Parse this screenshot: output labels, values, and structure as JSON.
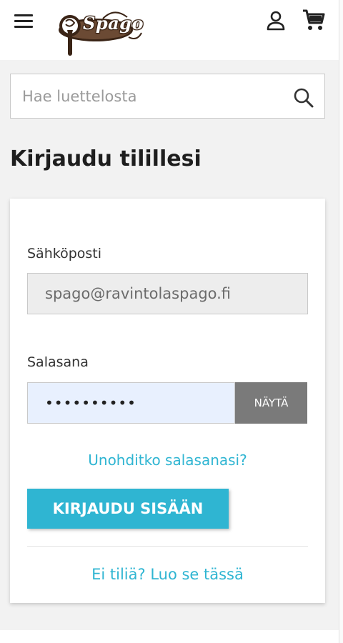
{
  "header": {
    "logo_text": "Spago",
    "menu_icon": "hamburger-menu-icon",
    "user_icon": "user-icon",
    "cart_icon": "shopping-cart-icon"
  },
  "search": {
    "placeholder": "Hae luettelosta",
    "value": "",
    "icon": "search-icon"
  },
  "page": {
    "title": "Kirjaudu tilillesi"
  },
  "login_form": {
    "email_label": "Sähköposti",
    "email_value": "spago@ravintolaspago.fi",
    "password_label": "Salasana",
    "password_value": "••••••••••",
    "show_button_label": "NÄYTÄ",
    "forgot_password_link": "Unohditko salasanasi?",
    "submit_button_label": "KIRJAUDU SISÄÄN",
    "register_link": "Ei tiliä? Luo se tässä"
  },
  "colors": {
    "accent": "#2fb5d2",
    "show_button_bg": "#7a7a7a",
    "autofill_bg": "#e8f0fe",
    "page_bg": "#f2f2f2",
    "logo_brown": "#3a2416"
  }
}
